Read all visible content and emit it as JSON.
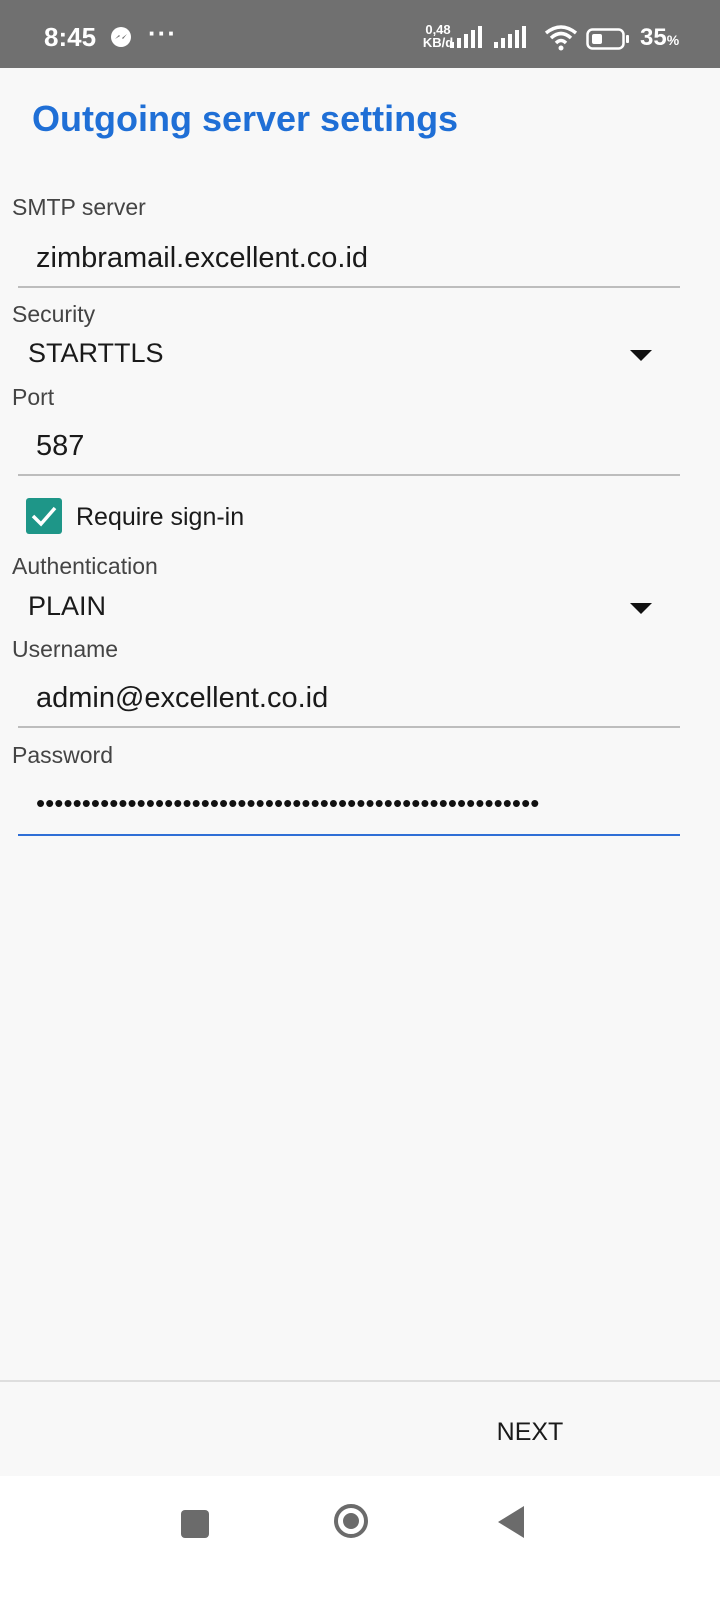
{
  "status_bar": {
    "time": "8:45",
    "dots": "···",
    "speed_value": "0,48",
    "speed_unit": "KB/d",
    "battery_percent": "35",
    "battery_suffix": "%"
  },
  "page": {
    "title": "Outgoing server settings"
  },
  "form": {
    "smtp_label": "SMTP server",
    "smtp_value": "zimbramail.excellent.co.id",
    "security_label": "Security",
    "security_value": "STARTTLS",
    "port_label": "Port",
    "port_value": "587",
    "require_signin_label": "Require sign-in",
    "require_signin_checked": true,
    "auth_label": "Authentication",
    "auth_value": "PLAIN",
    "username_label": "Username",
    "username_value": "admin@excellent.co.id",
    "password_label": "Password",
    "password_value": "•••••••••••••••••••••••••••••••••••••••••••••••••••••••"
  },
  "footer": {
    "next_label": "NEXT"
  },
  "colors": {
    "accent": "#1f6fd6",
    "checkbox": "#1e9688",
    "status_bar": "#707070"
  }
}
